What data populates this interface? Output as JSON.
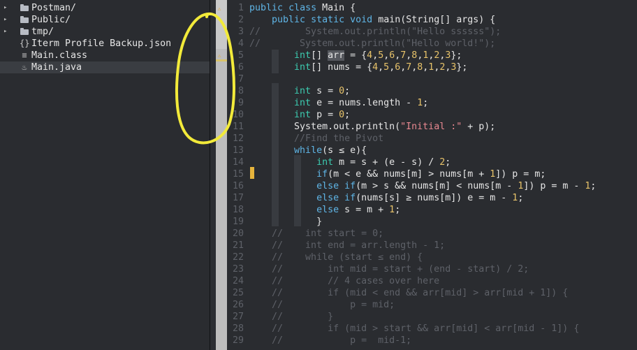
{
  "file_tree": {
    "items": [
      {
        "label": "Postman",
        "suffix": "/",
        "kind": "folder",
        "arrow": "▸"
      },
      {
        "label": "Public",
        "suffix": "/",
        "kind": "folder",
        "arrow": "▸"
      },
      {
        "label": "tmp",
        "suffix": "/",
        "kind": "folder",
        "arrow": "▸"
      },
      {
        "label": "Iterm Profile Backup.json",
        "suffix": "",
        "kind": "json",
        "icon_glyph": "{}"
      },
      {
        "label": "Main.class",
        "suffix": "",
        "kind": "class",
        "icon_glyph": "≡"
      },
      {
        "label": "Main.java",
        "suffix": "",
        "kind": "java",
        "icon_glyph": "♨",
        "selected": true
      }
    ]
  },
  "gutter": {
    "warning_glyph": "⚠",
    "warning_lines": [
      1,
      5
    ]
  },
  "editor": {
    "line_numbers": [
      "1",
      "2",
      "3",
      "4",
      "5",
      "6",
      "7",
      "8",
      "9",
      "10",
      "11",
      "12",
      "13",
      "14",
      "15",
      "16",
      "17",
      "18",
      "19",
      "20",
      "21",
      "22",
      "23",
      "24",
      "25",
      "26",
      "27",
      "28",
      "29"
    ],
    "lines": [
      "public class Main {",
      "    public static void main(String[] args) {",
      "//        System.out.println(\"Hello ssssss\");",
      "//       System.out.println(\"Hello world!\");",
      "        int[] arr = {4,5,6,7,8,1,2,3};",
      "        int[] nums = {4,5,6,7,8,1,2,3};",
      "",
      "        int s = 0;",
      "        int e = nums.length - 1;",
      "        int p = 0;",
      "        System.out.println(\"Initial :\" + p);",
      "        //Find the Pivot",
      "        while(s ≤ e){",
      "            int m = s + (e - s) / 2;",
      "            if(m < e && nums[m] > nums[m + 1]) p = m;",
      "            else if(m > s && nums[m] < nums[m - 1]) p = m - 1;",
      "            else if(nums[s] ≥ nums[m]) e = m - 1;",
      "            else s = m + 1;",
      "            }",
      "    //    int start = 0;",
      "    //    int end = arr.length - 1;",
      "    //    while (start ≤ end) {",
      "    //        int mid = start + (end - start) / 2;",
      "    //        // 4 cases over here",
      "    //        if (mid < end && arr[mid] > arr[mid + 1]) {",
      "    //            p = mid;",
      "    //        }",
      "    //        if (mid > start && arr[mid] < arr[mid - 1]) {",
      "    //            p =  mid-1;"
    ],
    "modified_line": 15
  },
  "colors": {
    "keyword": "#5fb5e6",
    "type": "#3ccbb0",
    "number": "#e8c36a",
    "string": "#e88890",
    "comment": "#5e6168",
    "annotation": "#f2ea3a"
  }
}
